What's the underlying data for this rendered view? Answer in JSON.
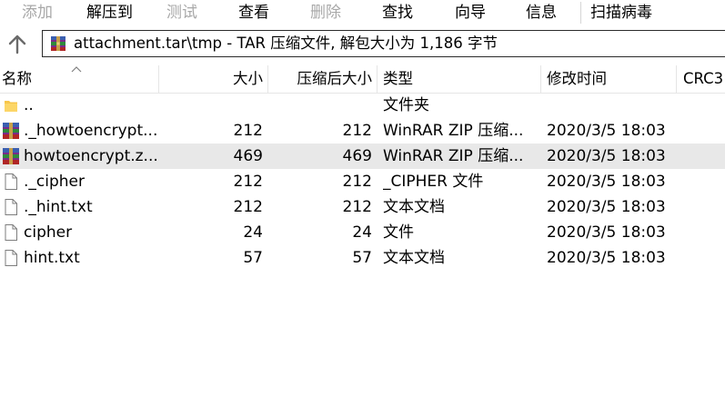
{
  "toolbar": {
    "items": [
      {
        "label": "添加",
        "enabled": false
      },
      {
        "label": "解压到",
        "enabled": true
      },
      {
        "label": "测试",
        "enabled": false
      },
      {
        "label": "查看",
        "enabled": true
      },
      {
        "label": "删除",
        "enabled": false
      },
      {
        "label": "查找",
        "enabled": true
      },
      {
        "label": "向导",
        "enabled": true
      },
      {
        "label": "信息",
        "enabled": true
      },
      {
        "label": "扫描病毒",
        "enabled": true
      }
    ]
  },
  "address": {
    "up_icon": "arrow-up-icon",
    "archive_icon": "winrar-archive-icon",
    "text": "attachment.tar\\tmp - TAR 压缩文件, 解包大小为 1,186 字节"
  },
  "columns": {
    "name": "名称",
    "size": "大小",
    "packed": "压缩后大小",
    "type": "类型",
    "modified": "修改时间",
    "crc": "CRC3"
  },
  "files": [
    {
      "icon": "folder-icon",
      "name": "..",
      "size": "",
      "packed": "",
      "type": "文件夹",
      "modified": "",
      "selected": false
    },
    {
      "icon": "winrar-archive-icon",
      "name": "._howtoencrypt....",
      "size": "212",
      "packed": "212",
      "type": "WinRAR ZIP 压缩...",
      "modified": "2020/3/5 18:03",
      "selected": false
    },
    {
      "icon": "winrar-archive-icon",
      "name": "howtoencrypt.z...",
      "size": "469",
      "packed": "469",
      "type": "WinRAR ZIP 压缩...",
      "modified": "2020/3/5 18:03",
      "selected": true
    },
    {
      "icon": "file-icon",
      "name": "._cipher",
      "size": "212",
      "packed": "212",
      "type": "_CIPHER 文件",
      "modified": "2020/3/5 18:03",
      "selected": false
    },
    {
      "icon": "file-icon",
      "name": "._hint.txt",
      "size": "212",
      "packed": "212",
      "type": "文本文档",
      "modified": "2020/3/5 18:03",
      "selected": false
    },
    {
      "icon": "file-icon",
      "name": "cipher",
      "size": "24",
      "packed": "24",
      "type": "文件",
      "modified": "2020/3/5 18:03",
      "selected": false
    },
    {
      "icon": "file-icon",
      "name": "hint.txt",
      "size": "57",
      "packed": "57",
      "type": "文本文档",
      "modified": "2020/3/5 18:03",
      "selected": false
    }
  ]
}
